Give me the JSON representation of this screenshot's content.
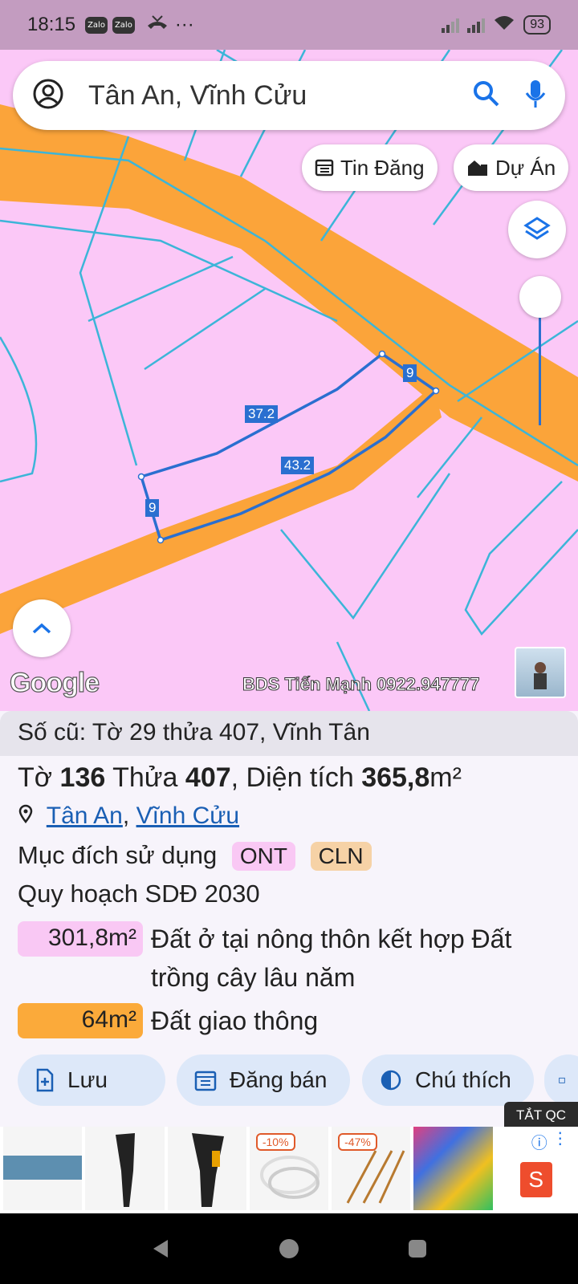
{
  "status_bar": {
    "time": "18:15",
    "zalo1": "Zalo",
    "zalo2": "Zalo",
    "more": "···",
    "battery": "93"
  },
  "search": {
    "query": "Tân An, Vĩnh Cửu"
  },
  "chips": {
    "tin_dang": "Tin Đăng",
    "du_an": "Dự Án"
  },
  "map": {
    "google_logo": "Google",
    "watermark": "BDS Tiến Mạnh 0922.947777",
    "edge_labels": [
      "37.2",
      "9",
      "43.2",
      "9"
    ]
  },
  "parcel": {
    "old_info": "Số cũ: Tờ 29 thửa 407, Vĩnh Tân",
    "to_label": "Tờ",
    "to_value": "136",
    "thua_label": "Thửa",
    "thua_value": "407",
    "dt_label": ", Diện tích",
    "dt_value": "365,8",
    "dt_unit": "m²",
    "location_1": "Tân An",
    "location_sep": ",",
    "location_2": "Vĩnh Cửu",
    "purpose_label": "Mục đích sử dụng",
    "purpose_tags": [
      "ONT",
      "CLN"
    ],
    "plan_label": "Quy hoạch SDĐ 2030",
    "plan_items": [
      {
        "area": "301,8m²",
        "desc": "Đất ở tại nông thôn kết hợp Đất trồng cây lâu năm",
        "color": "#f9c8f4"
      },
      {
        "area": "64m²",
        "desc": "Đất giao thông",
        "color": "#fbaa3a"
      }
    ]
  },
  "actions": {
    "save": "Lưu",
    "sell": "Đăng bán",
    "legend": "Chú thích"
  },
  "ads": {
    "close_label": "TẮT QC",
    "discount_1": "-10%",
    "discount_2": "-47%"
  },
  "colors": {
    "road": "#fba43a",
    "land": "#fbc8f7",
    "parcel_line": "#2a6fd0",
    "accent": "#1a73e8"
  }
}
